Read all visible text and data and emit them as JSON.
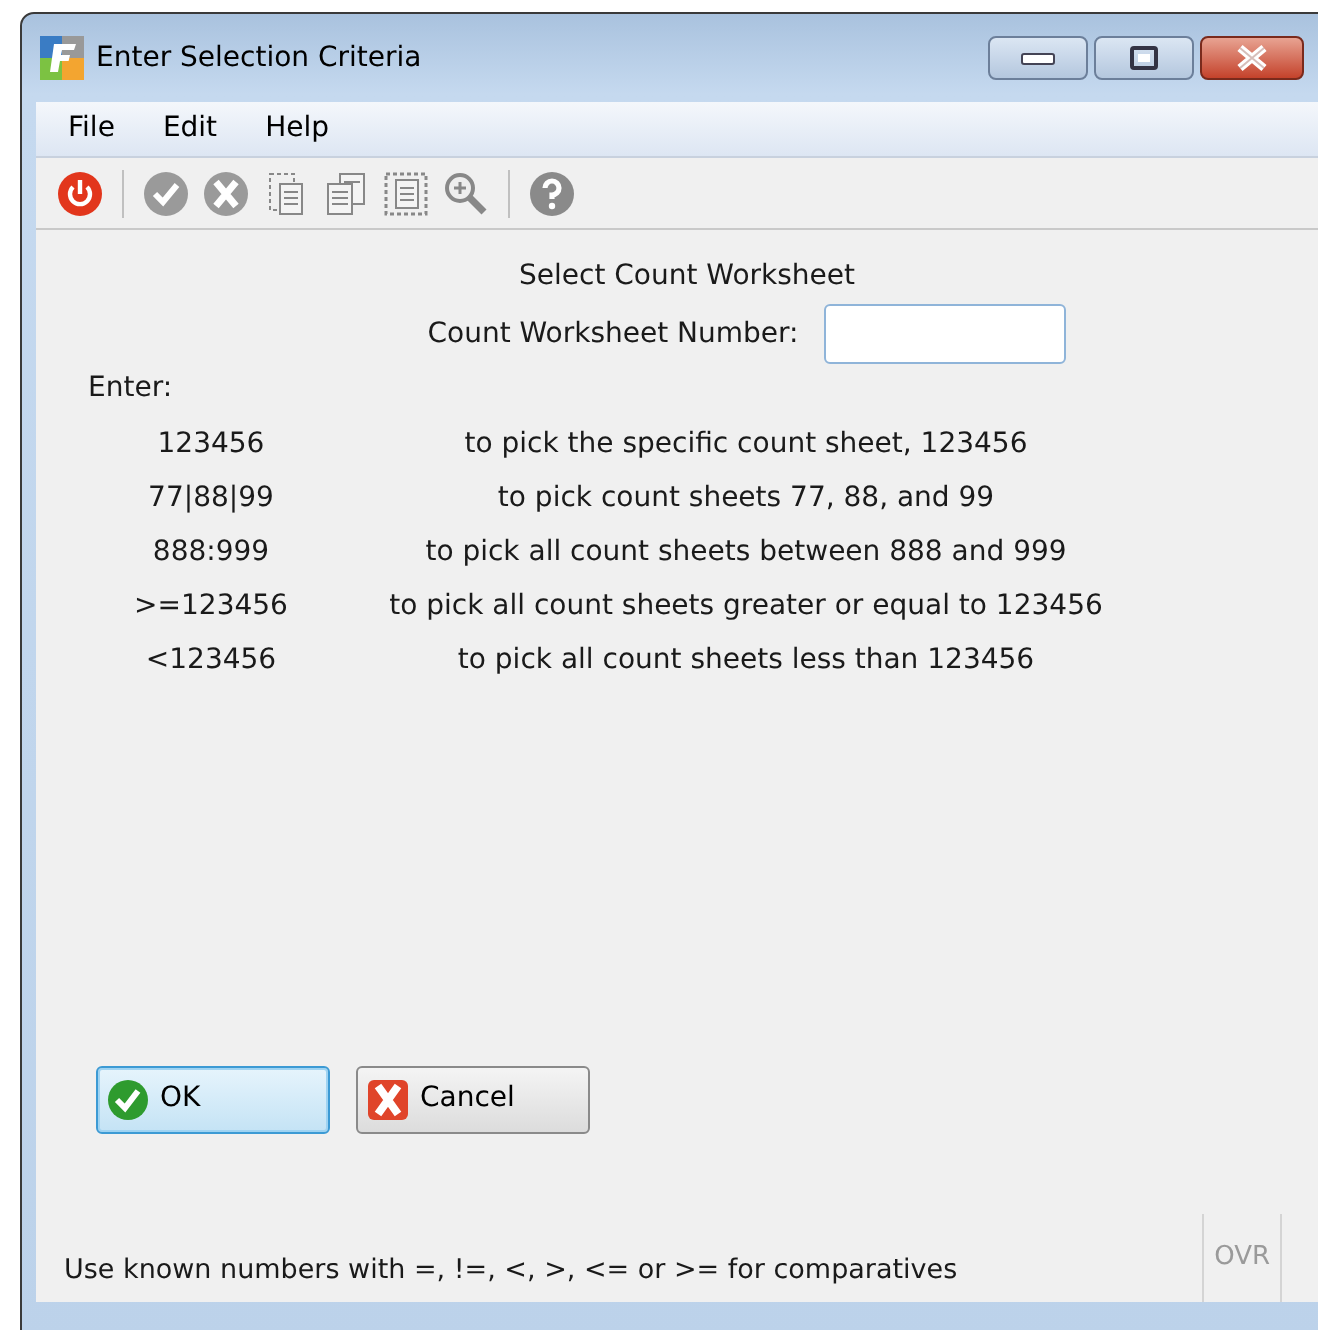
{
  "window": {
    "title": "Enter Selection Criteria"
  },
  "menu": [
    "File",
    "Edit",
    "Help"
  ],
  "toolbar": [
    {
      "kind": "power"
    },
    {
      "kind": "sep"
    },
    {
      "kind": "check"
    },
    {
      "kind": "cancel"
    },
    {
      "kind": "doc-dashed"
    },
    {
      "kind": "docs"
    },
    {
      "kind": "doc-frame"
    },
    {
      "kind": "zoom"
    },
    {
      "kind": "sep"
    },
    {
      "kind": "help"
    }
  ],
  "heading": "Select Count Worksheet",
  "field": {
    "label": "Count Worksheet Number:"
  },
  "enter_label": "Enter:",
  "examples": [
    {
      "pattern": "123456",
      "description": "to pick the specific count sheet, 123456"
    },
    {
      "pattern": "77|88|99",
      "description": "to pick count sheets 77, 88, and 99"
    },
    {
      "pattern": "888:999",
      "description": "to pick all count sheets between 888 and 999"
    },
    {
      "pattern": ">=123456",
      "description": "to pick all count sheets greater or equal to 123456"
    },
    {
      "pattern": "<123456",
      "description": "to pick all count sheets less than 123456"
    }
  ],
  "buttons": [
    {
      "kind": "ok",
      "label": "OK",
      "focused": true
    },
    {
      "kind": "cancel",
      "label": "Cancel",
      "focused": false
    }
  ],
  "status_bar": {
    "text": "Use known numbers with =, !=, <, >, <= or >= for comparatives",
    "indicator": {
      "label": "OVR",
      "active": false
    }
  }
}
